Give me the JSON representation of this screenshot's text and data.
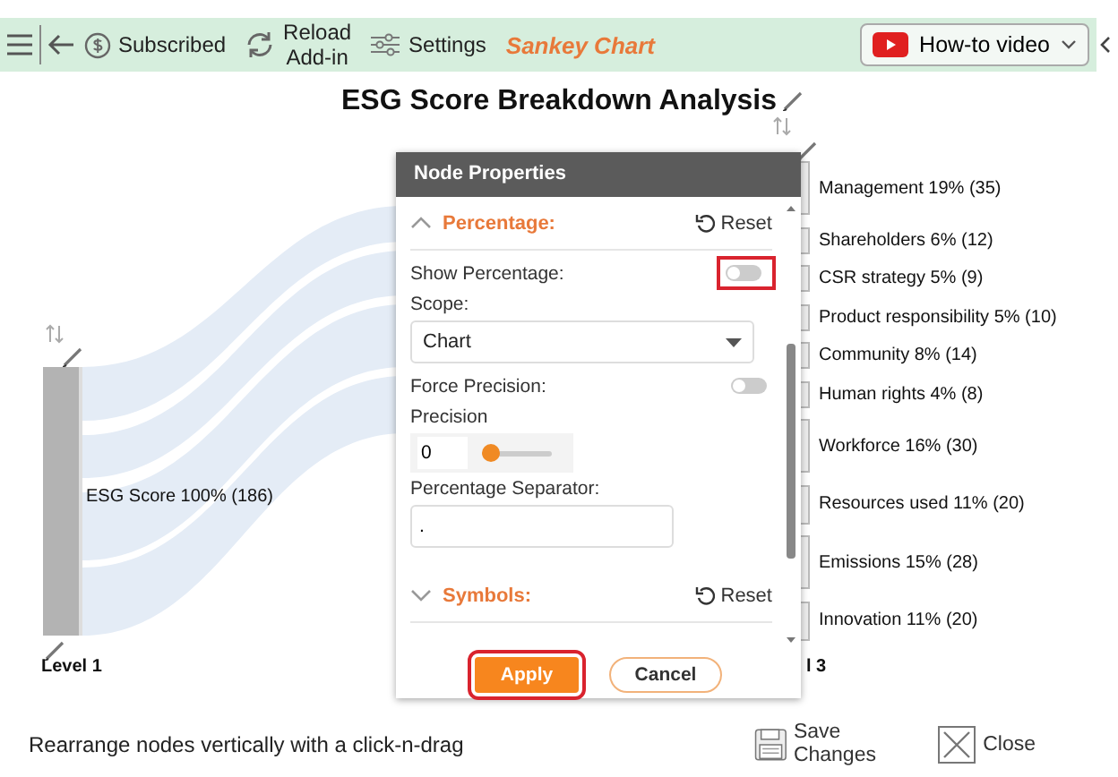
{
  "toolbar": {
    "subscribed": "Subscribed",
    "reload": "Reload Add-in",
    "settings": "Settings",
    "app_name": "Sankey Chart",
    "video_button": "How-to video"
  },
  "chart": {
    "title": "ESG Score Breakdown Analysis",
    "left_node": {
      "label": "ESG Score 100% (186)",
      "level": "Level 1"
    },
    "right_nodes": [
      {
        "label": "Management 19% (35)"
      },
      {
        "label": "Shareholders 6% (12)"
      },
      {
        "label": "CSR strategy 5% (9)"
      },
      {
        "label": "Product responsibility 5% (10)"
      },
      {
        "label": "Community 8% (14)"
      },
      {
        "label": "Human rights 4% (8)"
      },
      {
        "label": "Workforce 16% (30)"
      },
      {
        "label": "Resources used 11% (20)"
      },
      {
        "label": "Emissions 15% (28)"
      },
      {
        "label": "Innovation 11% (20)"
      }
    ],
    "right_level": "l 3"
  },
  "dialog": {
    "title": "Node Properties",
    "sections": [
      {
        "title": "Percentage:",
        "expanded": true,
        "reset": "Reset"
      },
      {
        "title": "Symbols:",
        "expanded": false,
        "reset": "Reset"
      }
    ],
    "show_percentage": {
      "label": "Show Percentage:",
      "on": false,
      "highlighted": true
    },
    "scope": {
      "label": "Scope:",
      "value": "Chart"
    },
    "force_precision": {
      "label": "Force Precision:",
      "on": false
    },
    "precision": {
      "label": "Precision",
      "value": "0",
      "level": 0
    },
    "separator": {
      "label": "Percentage Separator:",
      "value": "."
    },
    "apply": {
      "label": "Apply",
      "highlighted": true
    },
    "cancel": {
      "label": "Cancel"
    }
  },
  "footer": {
    "hint": "Rearrange nodes vertically with a click-n-drag",
    "save": "Save Changes",
    "close": "Close"
  }
}
